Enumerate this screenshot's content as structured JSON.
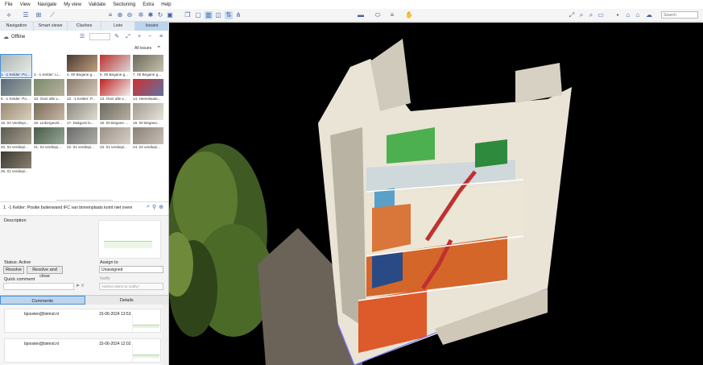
{
  "menu": [
    "File",
    "View",
    "Navigate",
    "My view",
    "Validate",
    "Sectioning",
    "Extra",
    "Help"
  ],
  "toolbar": {
    "search_placeholder": "Search"
  },
  "tabs": [
    "Navigation",
    "Smart views",
    "Clashes",
    "Lists",
    "Issues"
  ],
  "panel": {
    "status": "Offline",
    "all_issues": "All issues"
  },
  "issues": [
    {
      "label": "1. -1 Kelder: Po..."
    },
    {
      "label": "3. -1 Kelder: Li..."
    },
    {
      "label": "4. 00 Begane g..."
    },
    {
      "label": "5. 00 Begane g..."
    },
    {
      "label": "7. 00 Begane g..."
    },
    {
      "label": "8. -1 Kelder: Po..."
    },
    {
      "label": "10. Over alle v..."
    },
    {
      "label": "12. -1 Kelder: P..."
    },
    {
      "label": "13. Over alle v..."
    },
    {
      "label": "14. Hemelwate..."
    },
    {
      "label": "15. 02 Verdiepi..."
    },
    {
      "label": "16. Linkergevel..."
    },
    {
      "label": "17. Dakgoot lo..."
    },
    {
      "label": "18. 00 Begane ..."
    },
    {
      "label": "19. 00 Begane..."
    },
    {
      "label": "20. 02 verdiepi..."
    },
    {
      "label": "21. 02 verdiepi..."
    },
    {
      "label": "22. 02 verdiepi..."
    },
    {
      "label": "23. 01 verdiepi..."
    },
    {
      "label": "24. 02 verdiepi..."
    },
    {
      "label": "25. 01 verdiepi..."
    }
  ],
  "selected_issue": {
    "title": "1. -1 Kelder: Positie buitenwand IFC van binnenplaats komt niet overeen ...",
    "description_label": "Description",
    "status_label": "Status: Active",
    "resolve": "Resolve",
    "resolve_close": "Resolve and close",
    "assign_label": "Assign to",
    "assign_value": "Unassigned",
    "notify_label": "Notify",
    "notify_placeholder": "<select users to notify>",
    "quick_comment_label": "Quick comment"
  },
  "comment_tabs": [
    "Comments",
    "Details"
  ],
  "comments": [
    {
      "author": "bjoosten@bimnd.nl",
      "date": "15-06-2024 13:53"
    },
    {
      "author": "bjoosten@bimnd.nl",
      "date": "15-06-2024 12:02"
    }
  ]
}
